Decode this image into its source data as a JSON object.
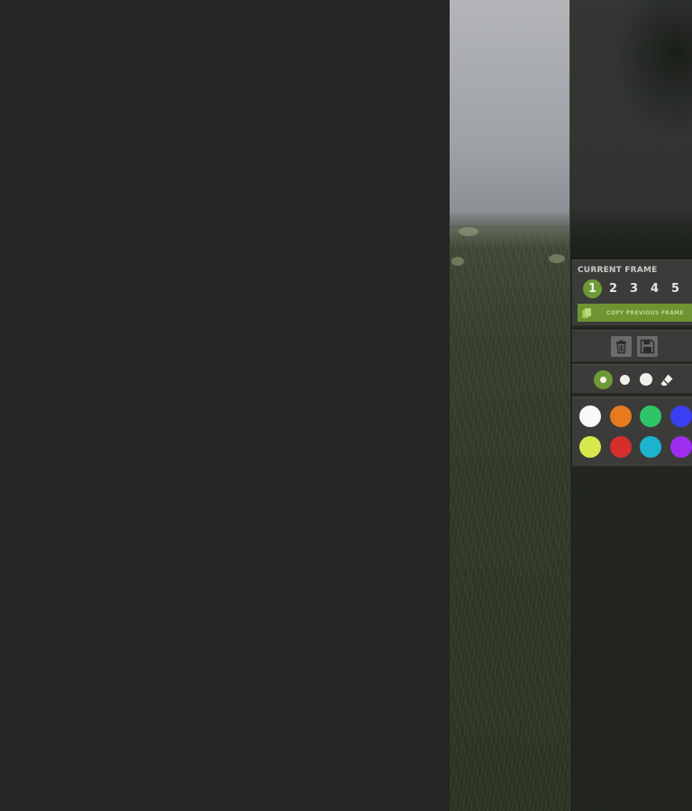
{
  "frames_panel": {
    "title": "CURRENT FRAME",
    "frames": [
      "1",
      "2",
      "3",
      "4",
      "5"
    ],
    "active_frame": "1",
    "copy_button_label": "COPY PREVIOUS FRAME"
  },
  "actions": {
    "delete_icon": "trash-icon",
    "save_icon": "floppy-disk-icon"
  },
  "brushes": {
    "selected": "large",
    "options": [
      "large",
      "small",
      "medium",
      "eraser"
    ]
  },
  "palette": {
    "colors": [
      {
        "name": "white",
        "hex": "#f8f8f6"
      },
      {
        "name": "orange",
        "hex": "#e87a1e"
      },
      {
        "name": "green",
        "hex": "#2fc46a"
      },
      {
        "name": "blue",
        "hex": "#3b3ff2"
      },
      {
        "name": "yellow",
        "hex": "#d7e84d"
      },
      {
        "name": "red",
        "hex": "#d62f2b"
      },
      {
        "name": "cyan",
        "hex": "#1eb3cc"
      },
      {
        "name": "purple",
        "hex": "#9e2df0"
      }
    ]
  },
  "theme": {
    "accent": "#6e9a36",
    "panel_bg": "#3b3c3a",
    "background": "#262524"
  }
}
